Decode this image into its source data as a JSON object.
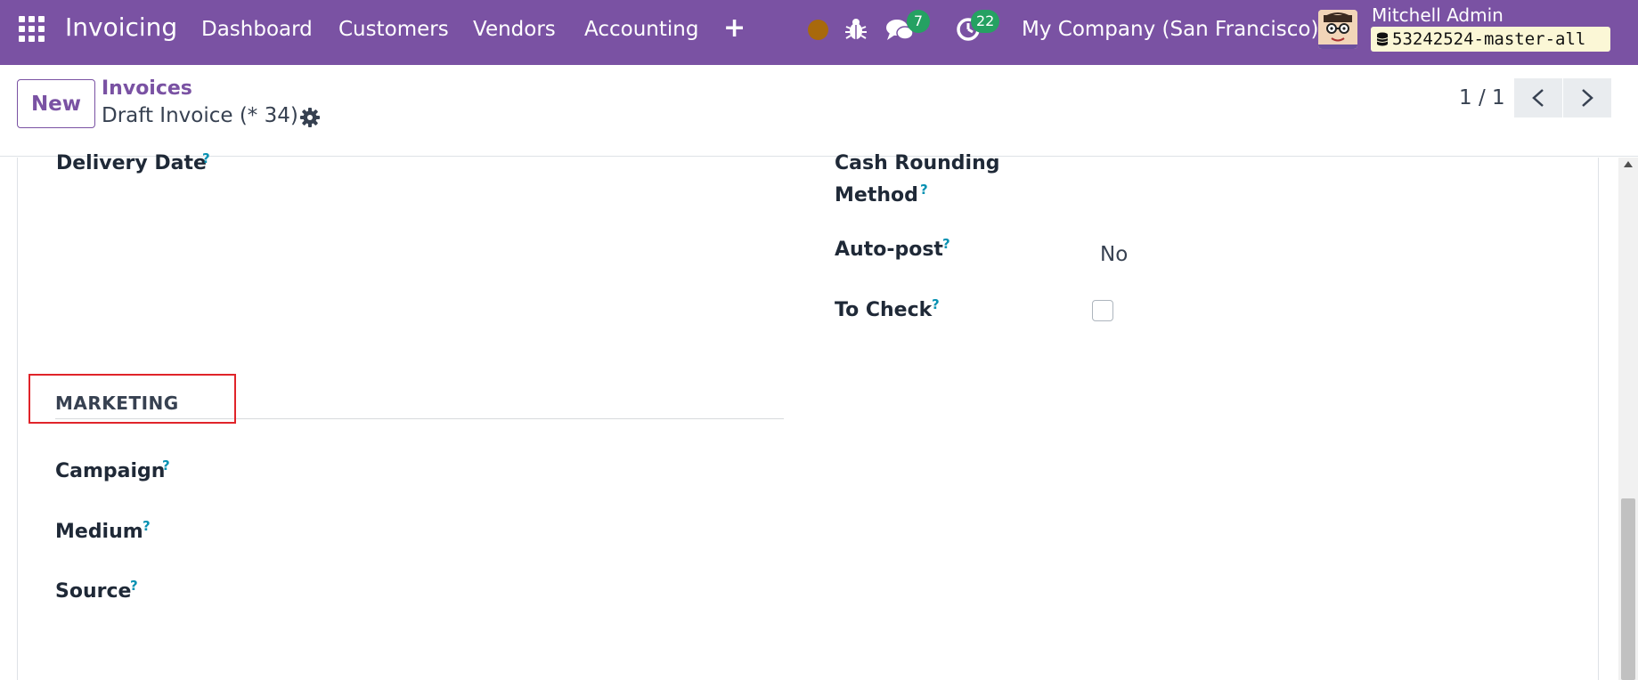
{
  "navbar": {
    "app_name": "Invoicing",
    "menu": [
      "Dashboard",
      "Customers",
      "Vendors",
      "Accounting"
    ],
    "plus_label": "+",
    "messages_count": "7",
    "activities_count": "22",
    "company": "My Company (San Francisco)",
    "user_name": "Mitchell Admin",
    "database": "53242524-master-all",
    "status_dot_color": "#a8690c",
    "bg_color": "#7a52a3",
    "badge_color": "#25a162"
  },
  "control": {
    "new_label": "New",
    "breadcrumb_parent": "Invoices",
    "record_title": "Draft Invoice (* 34)",
    "pager": "1 / 1"
  },
  "form": {
    "delivery_date_label": "Delivery Date",
    "cash_rounding_label_line1": "Cash Rounding",
    "cash_rounding_label_line2": "Method",
    "auto_post_label": "Auto-post",
    "auto_post_value": "No",
    "to_check_label": "To Check",
    "to_check_checked": false,
    "help_mark": "?",
    "marketing_title": "MARKETING",
    "campaign_label": "Campaign",
    "medium_label": "Medium",
    "source_label": "Source"
  },
  "highlight_color": "#e0242a"
}
